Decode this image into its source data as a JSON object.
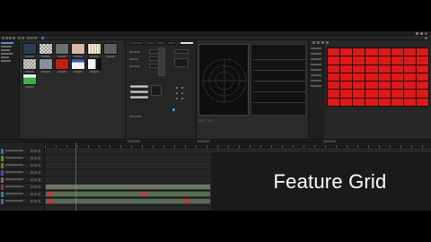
{
  "window": {
    "title": ""
  },
  "overlay": {
    "caption": "Feature Grid"
  },
  "colors": {
    "accent_red": "#e01818",
    "panel_bg": "#232323",
    "timeline_bg": "#262626",
    "clip_green": "#5a6b55",
    "marker_red": "#c9332d"
  },
  "media": {
    "thumbnails": [
      {
        "name": "dark-blue-thumb",
        "color": "#2c3b57"
      },
      {
        "name": "checker-thumb",
        "color": "#d9d9d9"
      },
      {
        "name": "gray-thumb",
        "color": "#6f6f6f"
      },
      {
        "name": "beige-thumb",
        "color": "#d7b8a8"
      },
      {
        "name": "stripes-thumb",
        "color": "#e9e2c9"
      },
      {
        "name": "gray2-thumb",
        "color": "#5e5e5e"
      },
      {
        "name": "checker2-thumb",
        "color": "#cfcfcf"
      },
      {
        "name": "slate-thumb",
        "color": "#8a8f99"
      },
      {
        "name": "red-thumb",
        "color": "#c61c16"
      },
      {
        "name": "blue-white-thumb",
        "color": "#f3f3f3"
      },
      {
        "name": "black-white-thumb",
        "color": "#111111"
      },
      {
        "name": "green-thumb",
        "color": "#38b04a"
      }
    ]
  },
  "red_grid": {
    "rows": 7,
    "cols": 8
  }
}
